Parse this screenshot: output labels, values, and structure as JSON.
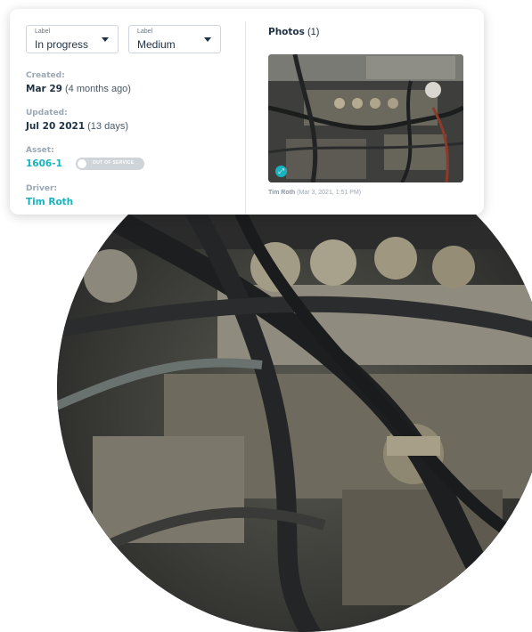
{
  "status_select": {
    "label": "Label",
    "value": "In progress"
  },
  "priority_select": {
    "label": "Label",
    "value": "Medium"
  },
  "created": {
    "label": "Created:",
    "date": "Mar 29",
    "relative": "(4 months ago)"
  },
  "updated": {
    "label": "Updated:",
    "date": "Jul 20 2021",
    "relative": "(13 days)"
  },
  "asset": {
    "label": "Asset:",
    "id": "1606-1",
    "status_toggle": "OUT OF SERVICE"
  },
  "driver": {
    "label": "Driver:",
    "name": "Tim Roth"
  },
  "photos": {
    "title": "Photos",
    "count": "(1)",
    "caption_author": "Tim Roth",
    "caption_date": "(Mar 3, 2021, 1:51 PM)"
  },
  "colors": {
    "accent": "#17b3be",
    "text": "#1f3144",
    "muted": "#9aa7b5"
  },
  "icons": {
    "select_caret": "caret-down-icon",
    "expand": "expand-icon"
  }
}
